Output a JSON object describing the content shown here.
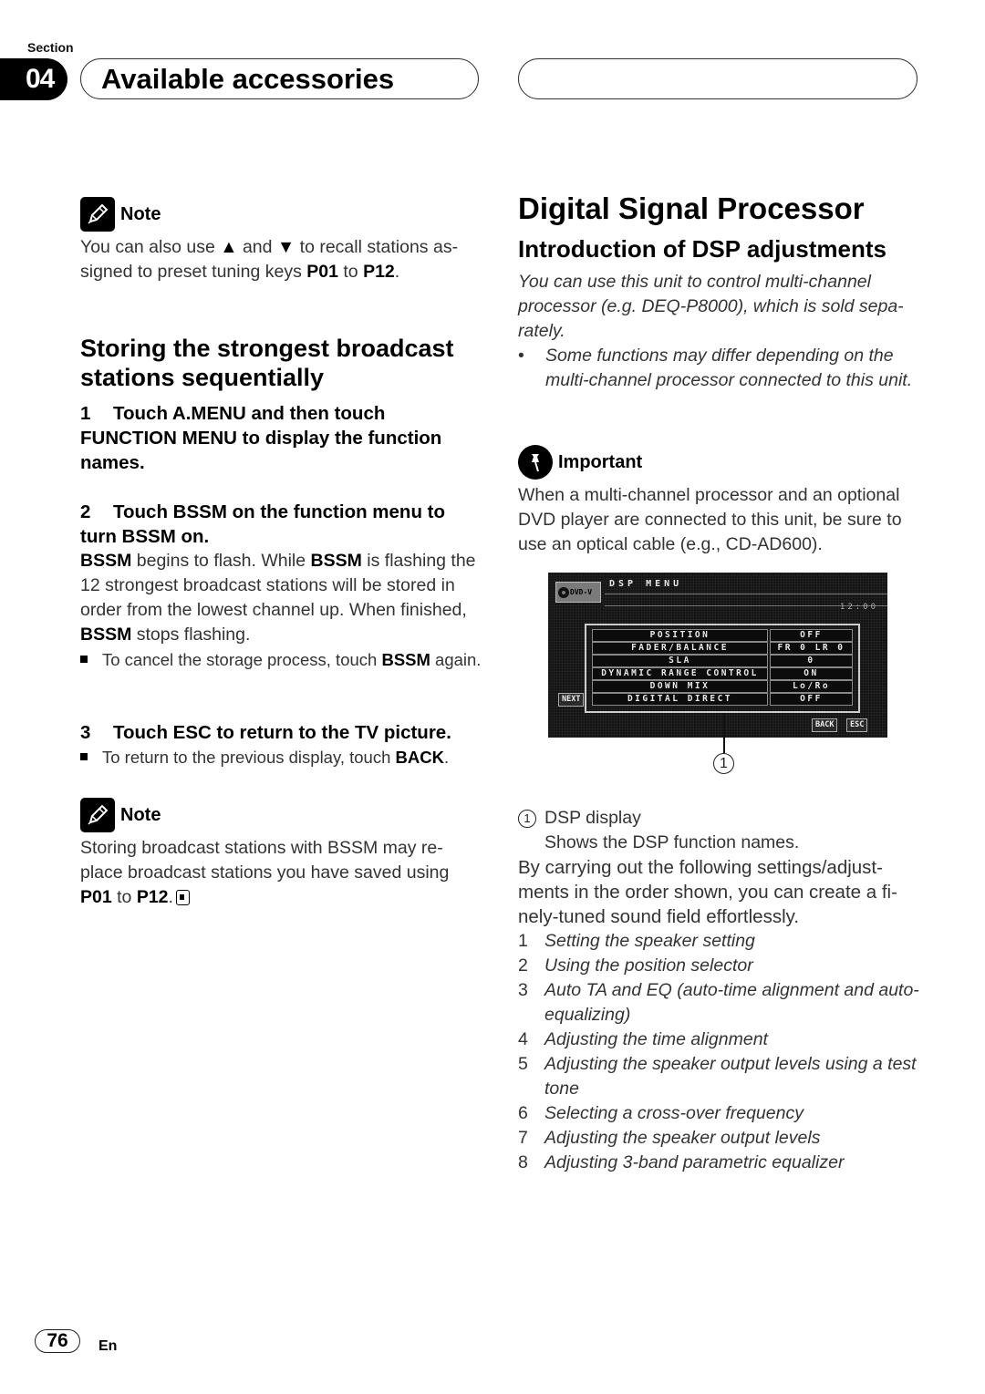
{
  "header": {
    "section_label": "Section",
    "section_number": "04",
    "title": "Available accessories"
  },
  "left": {
    "note1": {
      "title": "Note",
      "parts": [
        "You can also use ",
        "▲",
        " and ",
        "▼",
        " to recall stations as-signed to preset tuning keys ",
        "P01",
        " to ",
        "P12",
        "."
      ]
    },
    "heading": "Storing the strongest broadcast stations sequentially",
    "step1": {
      "num": "1",
      "text": "Touch A.MENU and then touch FUNCTION MENU to display the function names."
    },
    "step2": {
      "num": "2",
      "text": "Touch BSSM on the function menu to turn BSSM on.",
      "body": {
        "b1": "BSSM",
        "t1": " begins to flash. While ",
        "b2": "BSSM",
        "t2": " is flashing the 12 strongest broadcast stations will be stored in order from the lowest channel up. When finished, ",
        "b3": "BSSM",
        "t3": " stops flashing."
      },
      "bullet": {
        "text": "To cancel the storage process, touch ",
        "bold": "BSSM",
        "tail": " again."
      }
    },
    "step3": {
      "num": "3",
      "text": "Touch ESC to return to the TV picture.",
      "bullet": {
        "text": "To return to the previous display, touch ",
        "bold": "BACK",
        "tail": "."
      }
    },
    "note2": {
      "title": "Note",
      "text": "Storing broadcast stations with BSSM may re-place broadcast stations you have saved using ",
      "b1": "P01",
      "mid": " to ",
      "b2": "P12",
      "end": "."
    }
  },
  "right": {
    "h1": "Digital Signal Processor",
    "h2": "Introduction of DSP adjustments",
    "intro": "You can use this unit to control multi-channel processor (e.g. DEQ-P8000), which is sold sepa-rately.",
    "intro_bullet": "Some functions may differ depending on the multi-channel processor connected to this unit.",
    "important": {
      "title": "Important",
      "text": "When a multi-channel processor and an optional DVD player are connected to this unit, be sure to use an optical cable (e.g., CD-AD600)."
    },
    "screen": {
      "source": "DVD-V",
      "title": "DSP MENU",
      "time": "12:00",
      "rows": [
        {
          "key": "POSITION",
          "value": "OFF"
        },
        {
          "key": "FADER/BALANCE",
          "value": "FR 0 LR 0"
        },
        {
          "key": "SLA",
          "value": "0"
        },
        {
          "key": "DYNAMIC RANGE CONTROL",
          "value": "ON"
        },
        {
          "key": "DOWN MIX",
          "value": "Lo/Ro"
        },
        {
          "key": "DIGITAL DIRECT",
          "value": "OFF"
        }
      ],
      "next_label": "NEXT",
      "back_label": "BACK",
      "esc_label": "ESC"
    },
    "callout_num": "1",
    "caption": {
      "num": "1",
      "title": "DSP display",
      "desc": "Shows the DSP function names."
    },
    "paragraph": "By carrying out the following settings/adjust-ments in the order shown, you can create a fi-nely-tuned sound field effortlessly.",
    "steps": [
      {
        "num": "1",
        "text": "Setting the speaker setting"
      },
      {
        "num": "2",
        "text": "Using the position selector"
      },
      {
        "num": "3",
        "text": "Auto TA and EQ (auto-time alignment and auto-equalizing)"
      },
      {
        "num": "4",
        "text": "Adjusting the time alignment"
      },
      {
        "num": "5",
        "text": "Adjusting the speaker output levels using a test tone"
      },
      {
        "num": "6",
        "text": "Selecting a cross-over frequency"
      },
      {
        "num": "7",
        "text": "Adjusting the speaker output levels"
      },
      {
        "num": "8",
        "text": "Adjusting 3-band parametric equalizer"
      }
    ]
  },
  "footer": {
    "page": "76",
    "lang": "En"
  }
}
